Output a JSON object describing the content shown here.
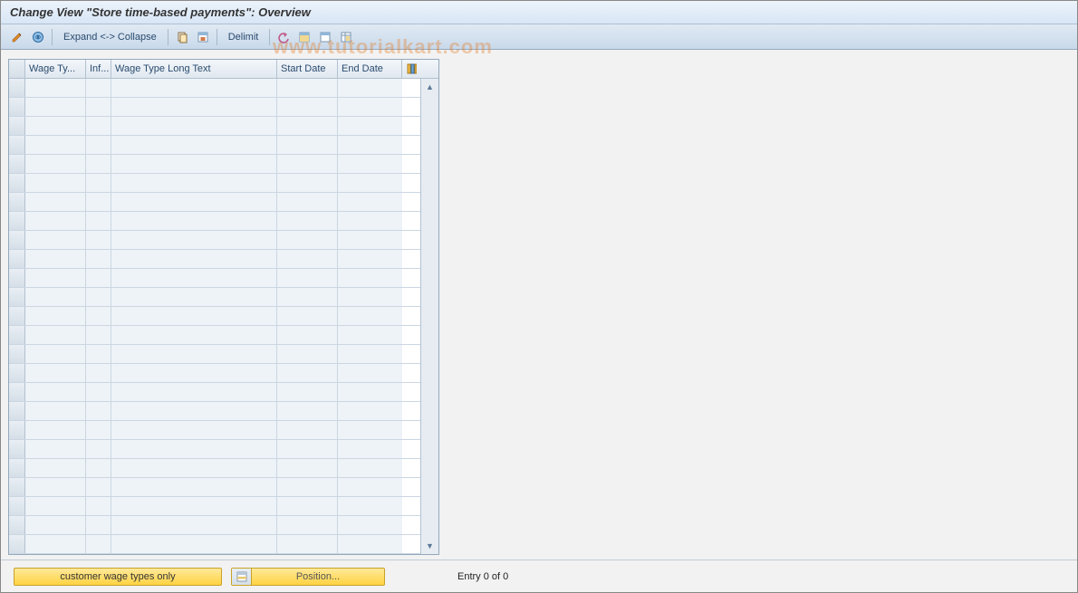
{
  "title": "Change View \"Store time-based payments\": Overview",
  "watermark": "www.tutorialkart.com",
  "toolbar": {
    "expand_collapse": "Expand <-> Collapse",
    "delimit": "Delimit"
  },
  "table": {
    "columns": {
      "wage_type": "Wage Ty...",
      "inf": "Inf...",
      "long_text": "Wage Type Long Text",
      "start_date": "Start Date",
      "end_date": "End Date"
    },
    "row_count": 25,
    "rows": []
  },
  "bottom": {
    "customer_wage": "customer wage types only",
    "position": "Position...",
    "entry": "Entry 0 of 0"
  }
}
